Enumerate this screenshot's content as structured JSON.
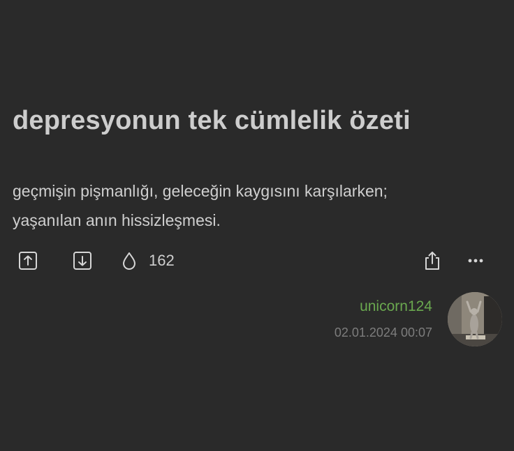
{
  "post": {
    "title": "depresyonun tek cümlelik özeti",
    "body": "geçmişin pişmanlığı, geleceğin kaygısını karşılarken;\nyaşanılan anın hissizleşmesi."
  },
  "actions": {
    "upvote_icon": "arrow-up-box-icon",
    "downvote_icon": "arrow-down-box-icon",
    "drop_icon": "droplet-icon",
    "drop_count": "162",
    "share_icon": "share-icon",
    "more_icon": "more-horizontal-icon"
  },
  "author": {
    "username": "unicorn124",
    "timestamp": "02.01.2024 00:07",
    "username_color": "#6aa84f"
  },
  "colors": {
    "background": "#2a2a2a",
    "text": "#cdcdcd",
    "muted": "#7d7d7d"
  }
}
